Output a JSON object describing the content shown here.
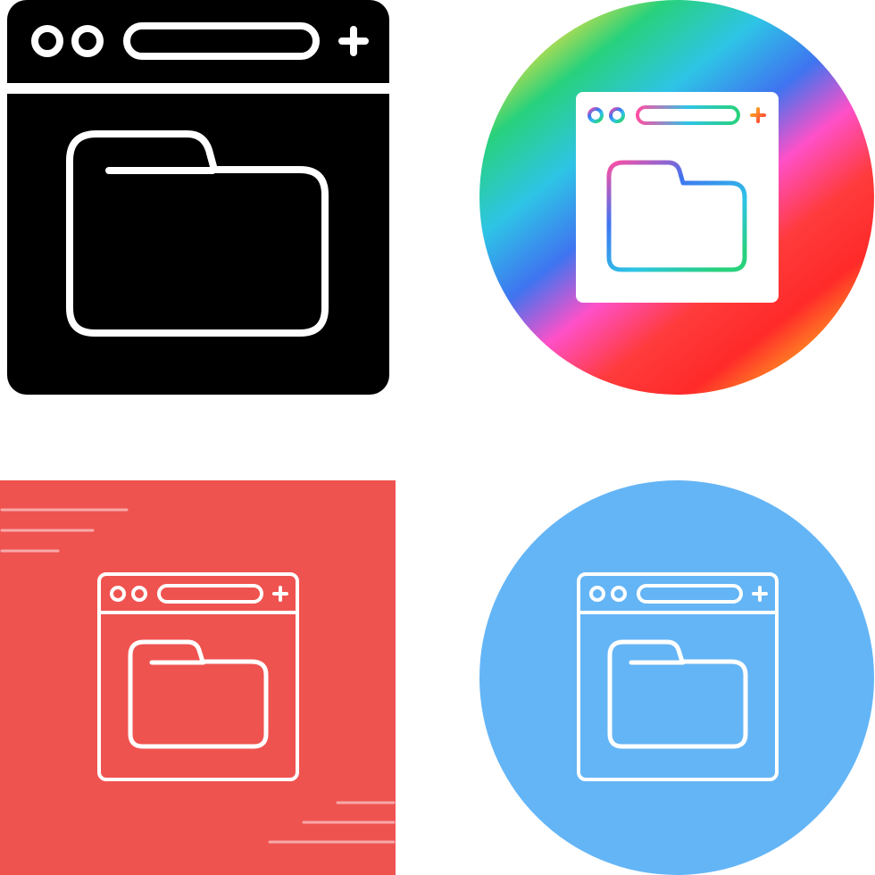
{
  "icon_set": {
    "subject": "browser-window-with-folder",
    "variants": [
      {
        "style": "glyph-black",
        "background": "none",
        "color": "#000000"
      },
      {
        "style": "gradient-circle",
        "background": "circle",
        "gradient": [
          "#28d17c",
          "#2ec4e6",
          "#3f74f0",
          "#ff50c8",
          "#ff3b3b",
          "#ff2a2a",
          "#ffb21f"
        ]
      },
      {
        "style": "outline-on-square",
        "background": "square",
        "color": "#ef5350"
      },
      {
        "style": "outline-on-circle",
        "background": "circle",
        "color": "#64b5f6"
      }
    ]
  }
}
